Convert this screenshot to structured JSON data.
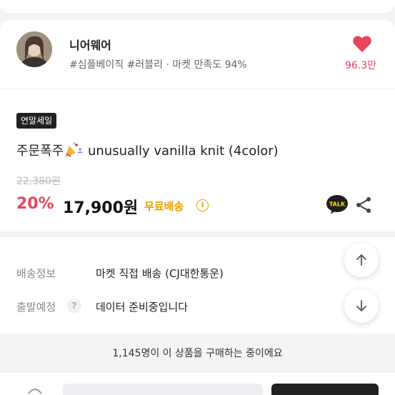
{
  "shop": {
    "name": "니어웨어",
    "meta": "#심플베이직 #러블리 · 마켓 만족도 94%",
    "likes": "96.3만"
  },
  "product": {
    "badge": "연말세일",
    "title_prefix": "주문폭주",
    "title_suffix": "unusually vanilla knit (4color)",
    "original_price": "22,380원",
    "discount": "20%",
    "price": "17,900원",
    "free_shipping": "무료배송",
    "info_glyph": "i",
    "talk_label": "TALK"
  },
  "delivery": {
    "shipping_label": "배송정보",
    "shipping_value": "마켓 직접 배송 (CJ대한통운)",
    "dispatch_label": "출발예정",
    "dispatch_help": "?",
    "dispatch_value": "데이터 준비중입니다"
  },
  "buying_now": "1,145명이 이 상품을 구매하는 중이에요",
  "colors": {
    "accent_red": "#e8455a",
    "free_ship_yellow": "#e6a100",
    "kakao_yellow": "#f7e600"
  },
  "icons": [
    "heart-icon",
    "party-popper-icon",
    "info-icon",
    "kakaotalk-icon",
    "share-icon",
    "question-icon",
    "arrow-up-icon",
    "arrow-down-icon"
  ]
}
